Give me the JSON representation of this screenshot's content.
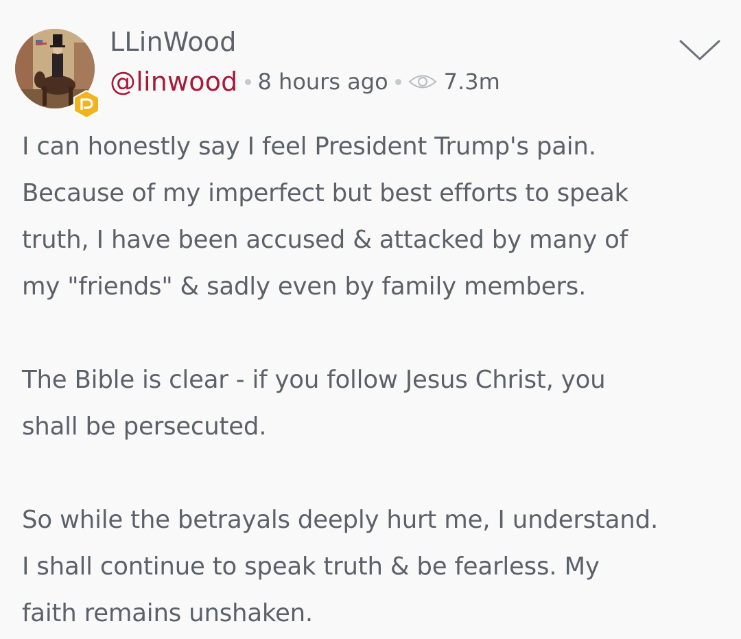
{
  "post": {
    "display_name": "LLinWood",
    "handle": "@linwood",
    "time_ago": "8 hours ago",
    "views": "7.3m",
    "icons": {
      "avatar": "profile-photo",
      "badge": "parler-p-badge",
      "views": "eye-icon",
      "menu": "chevron-down-icon"
    },
    "colors": {
      "handle": "#a8193a",
      "badge": "#f0b51e",
      "text": "#5c6169",
      "background": "#f9f9fa"
    },
    "paragraphs": [
      {
        "lines": [
          "I can honestly say I feel President Trump's pain.",
          "Because of my imperfect but best efforts to speak",
          "truth, I have been accused & attacked by many of",
          "my \"friends\" & sadly even by family members."
        ]
      },
      {
        "lines": [
          "The Bible is clear - if you follow Jesus Christ, you",
          "shall be persecuted."
        ]
      },
      {
        "lines": [
          "So while the betrayals deeply hurt me, I understand.",
          "I shall continue to speak truth & be fearless. My",
          "faith remains unshaken."
        ]
      }
    ]
  }
}
